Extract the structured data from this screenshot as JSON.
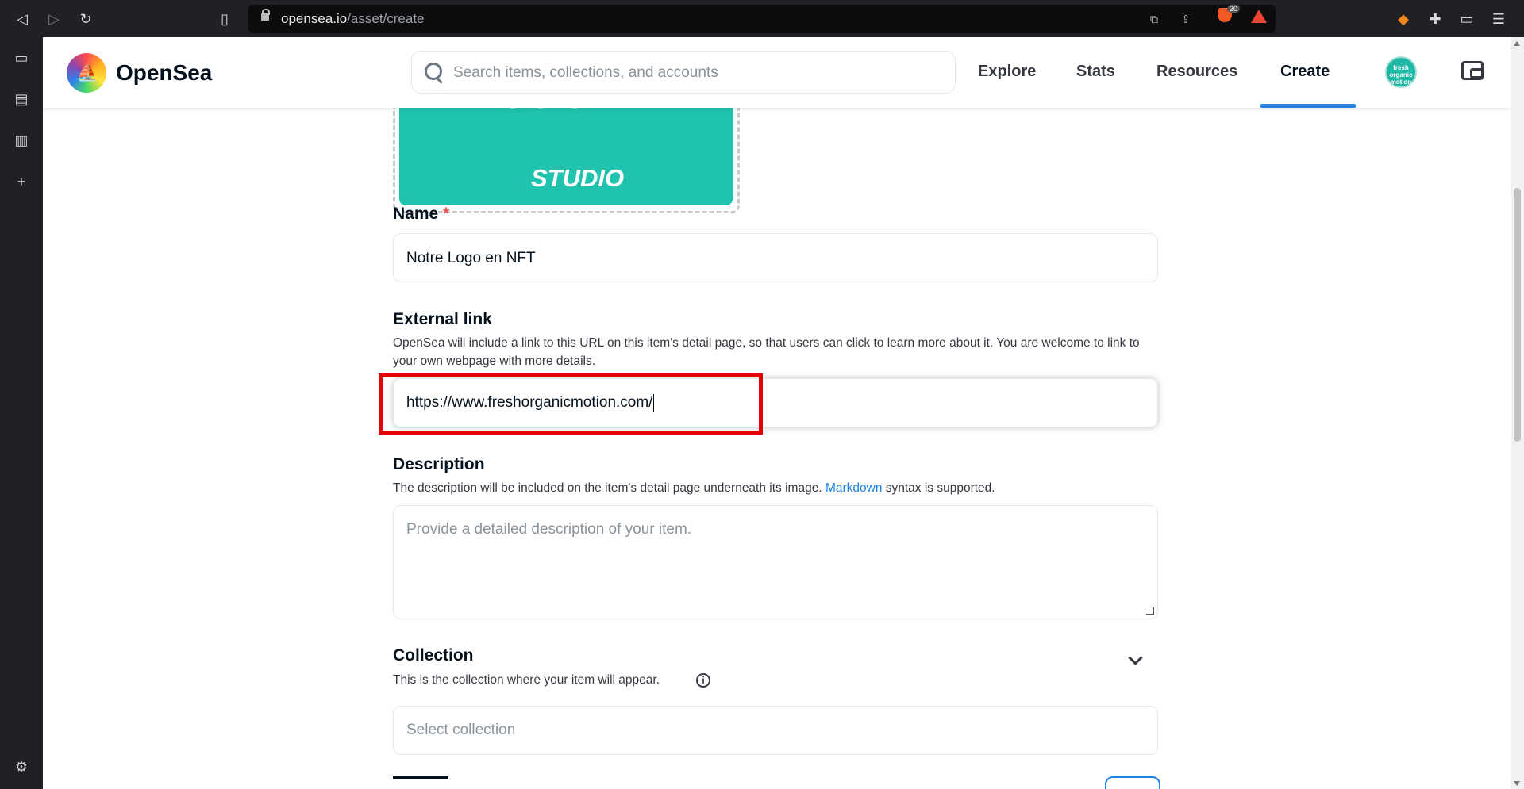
{
  "browser": {
    "url_domain": "opensea.io",
    "url_path": "/asset/create",
    "extension_badge": "20"
  },
  "header": {
    "brand": "OpenSea",
    "search_placeholder": "Search items, collections, and accounts",
    "nav": [
      "Explore",
      "Stats",
      "Resources",
      "Create"
    ],
    "active_nav": "Create",
    "avatar_text": "fresh organic motion"
  },
  "preview": {
    "caption": "STUDIO",
    "partial_text": "motio"
  },
  "form": {
    "name": {
      "label": "Name",
      "required_mark": "*",
      "value": "Notre Logo en NFT"
    },
    "external_link": {
      "label": "External link",
      "hint": "OpenSea will include a link to this URL on this item's detail page, so that users can click to learn more about it. You are welcome to link to your own webpage with more details.",
      "value": "https://www.freshorganicmotion.com/"
    },
    "description": {
      "label": "Description",
      "hint_before": "The description will be included on the item's detail page underneath its image.",
      "hint_link": "Markdown",
      "hint_after": "syntax is supported.",
      "placeholder": "Provide a detailed description of your item."
    },
    "collection": {
      "label": "Collection",
      "hint": "This is the collection where your item will appear.",
      "placeholder": "Select collection"
    }
  },
  "colors": {
    "accent": "#2081e2",
    "highlight_box": "#e3000b",
    "required": "#eb5757",
    "preview_bg": "#20c3ad"
  }
}
